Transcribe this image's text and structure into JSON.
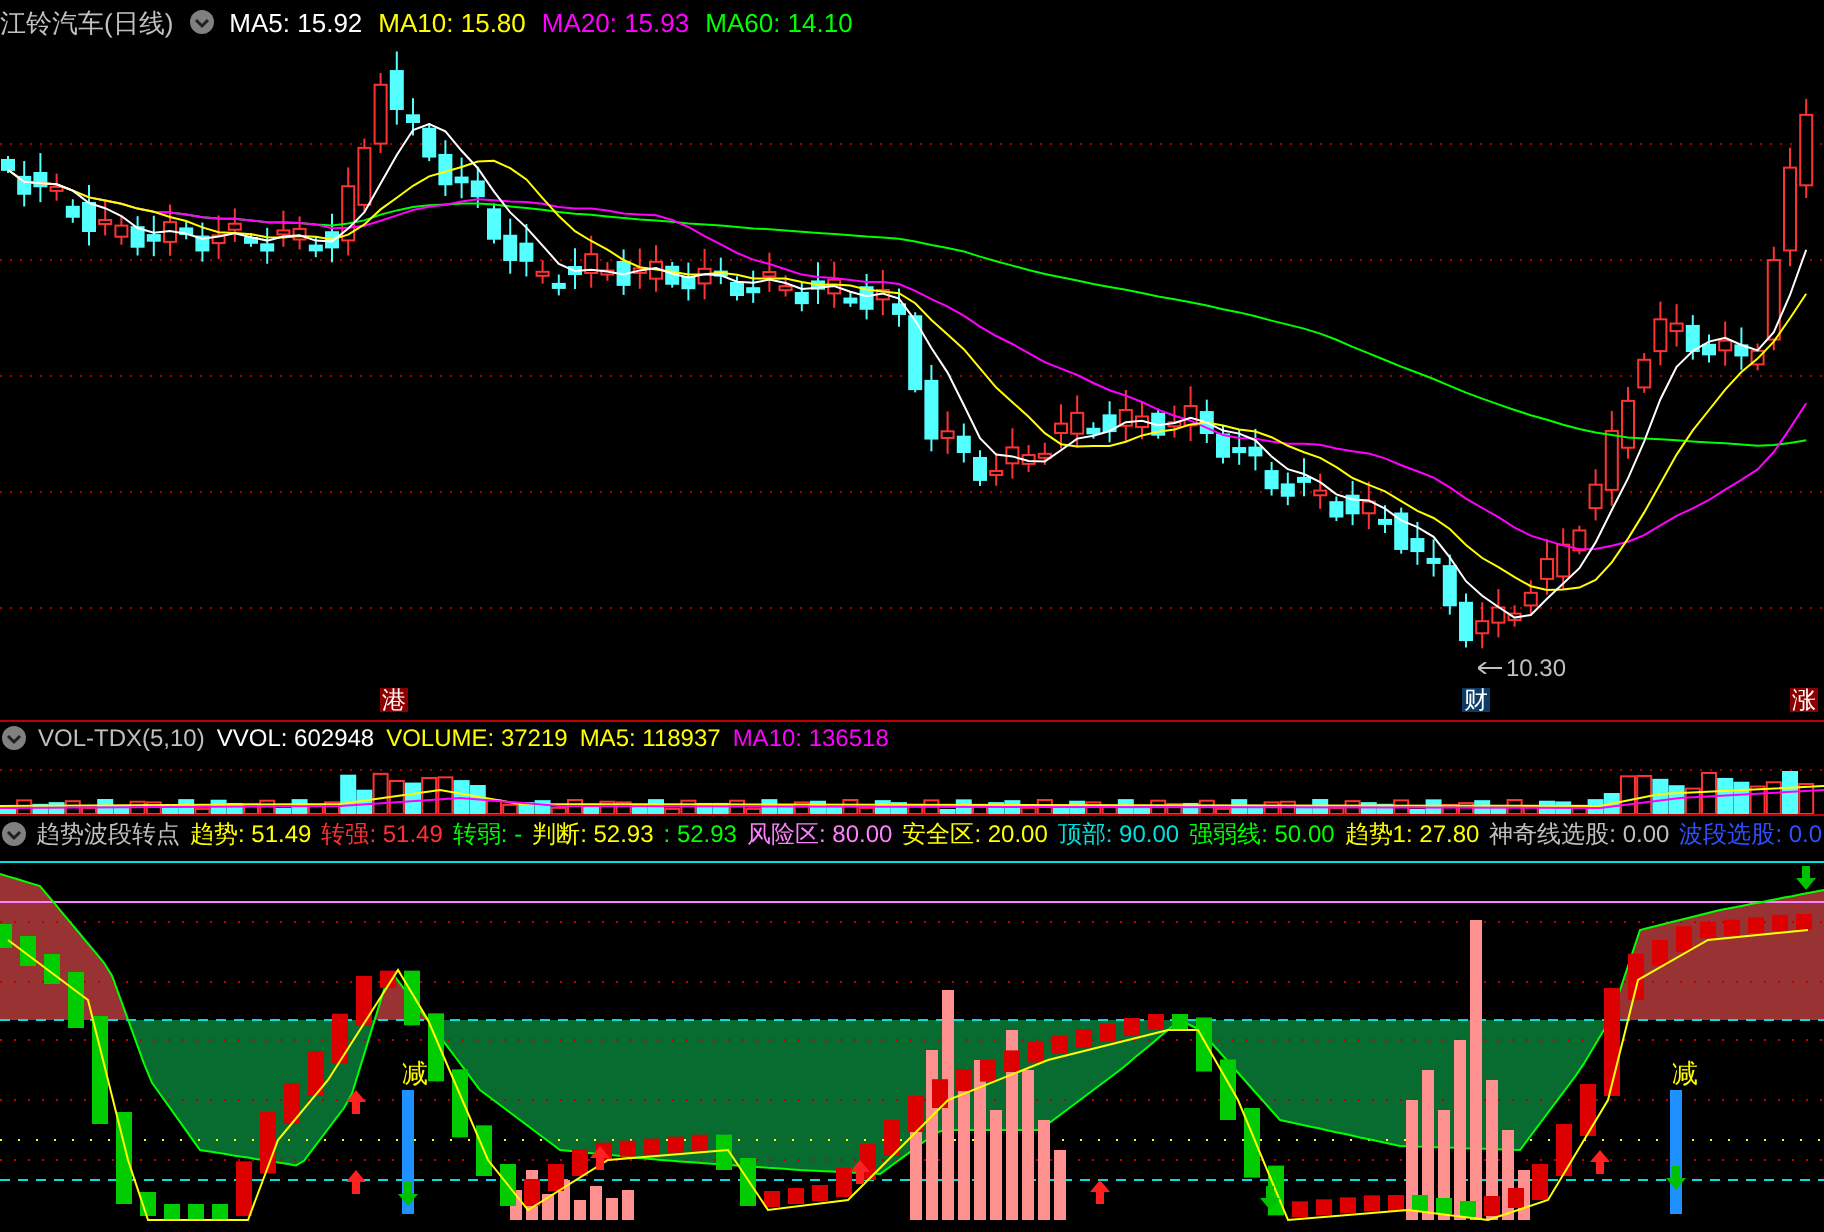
{
  "stock": {
    "title": "江铃汽车(日线)"
  },
  "price_legend": [
    {
      "text": "MA5: 15.92",
      "color": "#ffffff"
    },
    {
      "text": "MA10: 15.80",
      "color": "#ffff00"
    },
    {
      "text": "MA20: 15.93",
      "color": "#ff00ff"
    },
    {
      "text": "MA60: 14.10",
      "color": "#00ff00"
    }
  ],
  "price_markers": [
    {
      "text": "港",
      "color": "#8b0000"
    },
    {
      "text": "财",
      "color": "#0c3b66"
    },
    {
      "text": "涨",
      "color": "#8b0000"
    }
  ],
  "low_price_label": "10.30",
  "volume_panel": {
    "title": "VOL-TDX(5,10)",
    "legend": [
      {
        "text": "VVOL: 602948",
        "color": "#ffffff"
      },
      {
        "text": "VOLUME: 37219",
        "color": "#ffff00"
      },
      {
        "text": "MA5: 118937",
        "color": "#ffff00"
      },
      {
        "text": "MA10: 136518",
        "color": "#ff00ff"
      }
    ]
  },
  "indicator_panel": {
    "title": "趋势波段转点",
    "legend": [
      {
        "text": "趋势: 51.49",
        "color": "#ffff00"
      },
      {
        "text": "转强: 51.49",
        "color": "#ff3232"
      },
      {
        "text": "转弱: -",
        "color": "#00ff00"
      },
      {
        "text": "判断: 52.93",
        "color": "#ffff00"
      },
      {
        "text": ": 52.93",
        "color": "#00ff00"
      },
      {
        "text": "风险区: 80.00",
        "color": "#ff80ff"
      },
      {
        "text": "安全区: 20.00",
        "color": "#ffff00"
      },
      {
        "text": "顶部: 90.00",
        "color": "#00e0e0"
      },
      {
        "text": "强弱线: 50.00",
        "color": "#00ff00"
      },
      {
        "text": "趋势1: 27.80",
        "color": "#ffff00"
      },
      {
        "text": "神奇线选股: 0.00",
        "color": "#c0c0c0"
      },
      {
        "text": "波段选股: 0.0",
        "color": "#3050ff"
      }
    ],
    "signal_labels": [
      "减",
      "减"
    ]
  }
}
